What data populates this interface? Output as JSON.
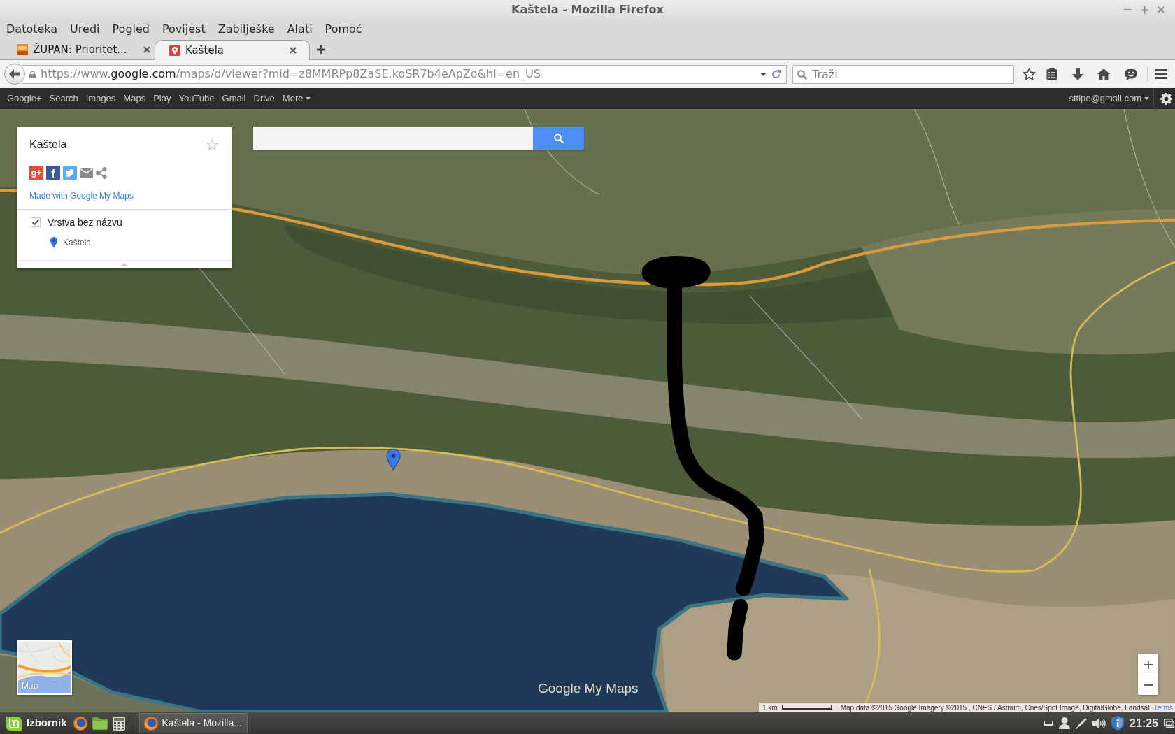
{
  "window": {
    "title": "Kaštela - Mozilla Firefox"
  },
  "menu_bar": [
    {
      "key": "D",
      "post": "atoteka"
    },
    {
      "pre": "Ur",
      "key": "e",
      "post": "di"
    },
    {
      "pre": "Po",
      "key": "g",
      "post": "led"
    },
    {
      "pre": "Povije",
      "key": "s",
      "post": "t"
    },
    {
      "pre": "Za",
      "key": "b",
      "post": "ilješke"
    },
    {
      "pre": "Ala",
      "key": "t",
      "post": "i"
    },
    {
      "key": "P",
      "post": "omoć"
    }
  ],
  "tabs": [
    {
      "title": "ŽUPAN: Prioritet...",
      "kind": "portal",
      "selected": false
    },
    {
      "title": "Kaštela",
      "kind": "maps",
      "selected": true
    }
  ],
  "toolbar": {
    "url_parts": [
      "https://www.",
      "google.com",
      "/maps/d/viewer?mid=z8MMRPp8ZaSE.koSR7b4eApZo&hl=en_US"
    ],
    "search": {
      "placeholder": "Traži"
    }
  },
  "google_bar": {
    "links": [
      "Google+",
      "Search",
      "Images",
      "Maps",
      "Play",
      "YouTube",
      "Gmail",
      "Drive"
    ],
    "more": "More",
    "account": "sttipe@gmail.com"
  },
  "map": {
    "panel": {
      "title": "Kaštela",
      "share_buttons": [
        {
          "kind": "google_plus",
          "glyph": "g+"
        },
        {
          "kind": "facebook",
          "glyph": "f"
        },
        {
          "kind": "twitter"
        },
        {
          "kind": "email"
        },
        {
          "kind": "share"
        }
      ],
      "credit_link": "Made with Google My Maps",
      "layers": [
        {
          "name": "Vrstva bez názvu",
          "checked": true,
          "places": [
            "Kaštela"
          ]
        }
      ]
    },
    "map_type": "Map",
    "logo": "Google My Maps",
    "scale": "1 km",
    "attribution": "Map data ©2015 Google Imagery ©2015 , CNES / Astrium, Cnes/Spot Image, DigitalGlobe, Landsat",
    "terms": "Terms"
  },
  "taskbar": {
    "menu_label": "Izbornik",
    "launchers": [
      {
        "kind": "browser"
      },
      {
        "kind": "files"
      },
      {
        "kind": "calculator"
      }
    ],
    "windows": [
      {
        "title": "Kaštela - Mozilla...",
        "kind": "browser"
      }
    ],
    "clock": "21:25"
  }
}
